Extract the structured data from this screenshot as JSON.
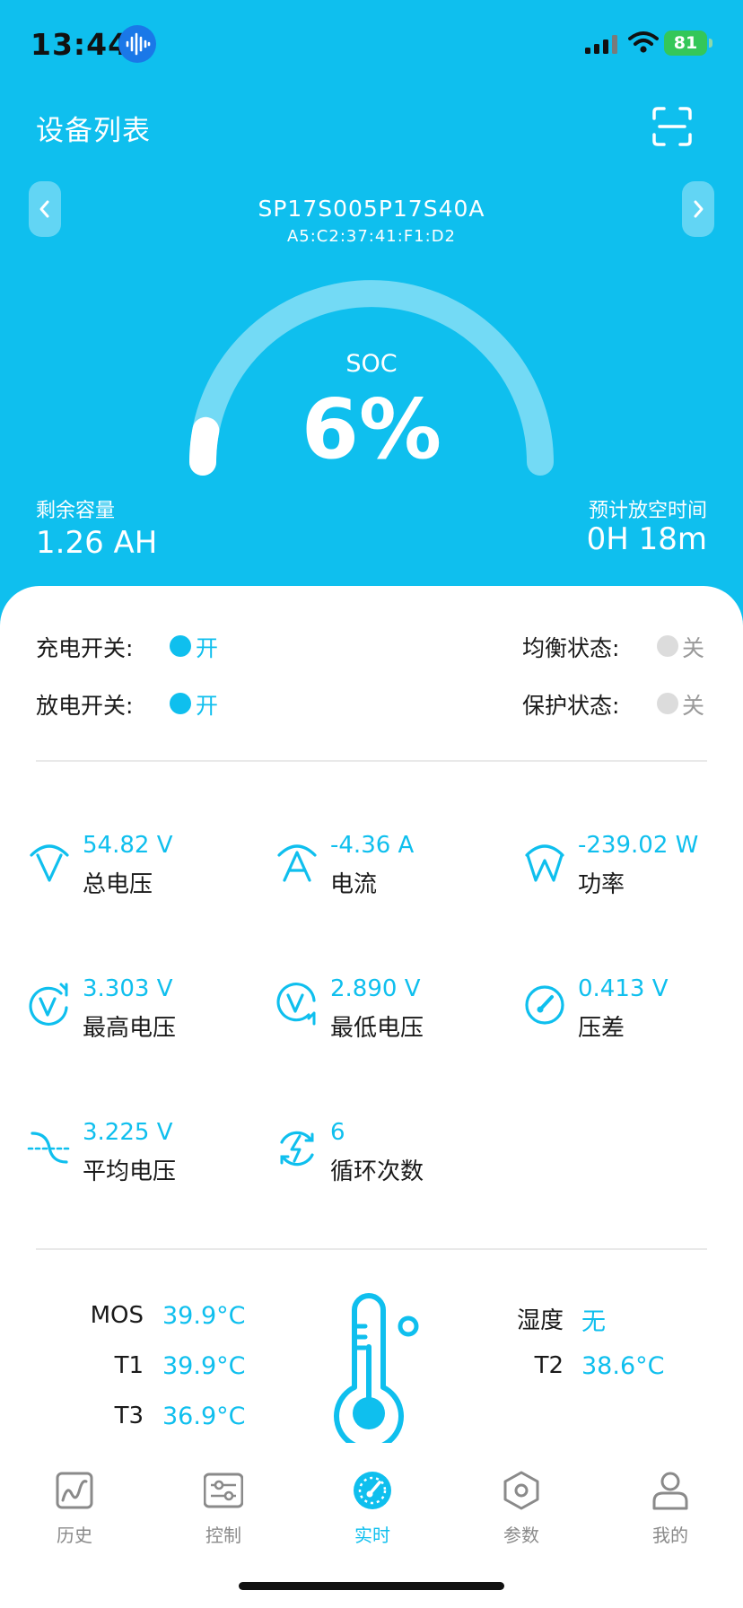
{
  "status_bar": {
    "time": "13:44",
    "battery": "81"
  },
  "header": {
    "title": "设备列表"
  },
  "device": {
    "name": "SP17S005P17S40A",
    "mac": "A5:C2:37:41:F1:D2"
  },
  "soc": {
    "label": "SOC",
    "value": "6%",
    "level": 0.06
  },
  "remaining": {
    "label": "剩余容量",
    "value": "1.26 AH"
  },
  "eta": {
    "label": "预计放空时间",
    "value": "0H 18m"
  },
  "switches": {
    "charge": {
      "label": "充电开关:",
      "state": "开"
    },
    "discharge": {
      "label": "放电开关:",
      "state": "开"
    },
    "balance": {
      "label": "均衡状态:",
      "state": "关"
    },
    "protect": {
      "label": "保护状态:",
      "state": "关"
    }
  },
  "metrics": [
    {
      "icon": "total-voltage-icon",
      "value": "54.82 V",
      "label": "总电压"
    },
    {
      "icon": "current-icon",
      "value": "-4.36 A",
      "label": "电流"
    },
    {
      "icon": "power-icon",
      "value": "-239.02 W",
      "label": "功率"
    },
    {
      "icon": "max-voltage-icon",
      "value": "3.303 V",
      "label": "最高电压"
    },
    {
      "icon": "min-voltage-icon",
      "value": "2.890 V",
      "label": "最低电压"
    },
    {
      "icon": "voltage-diff-icon",
      "value": "0.413 V",
      "label": "压差"
    },
    {
      "icon": "avg-voltage-icon",
      "value": "3.225 V",
      "label": "平均电压"
    },
    {
      "icon": "cycle-icon",
      "value": "6",
      "label": "循环次数"
    }
  ],
  "temps": {
    "mos": {
      "label": "MOS",
      "value": "39.9°C"
    },
    "t1": {
      "label": "T1",
      "value": "39.9°C"
    },
    "t3": {
      "label": "T3",
      "value": "36.9°C"
    },
    "humidity": {
      "label": "湿度",
      "value": "无"
    },
    "t2": {
      "label": "T2",
      "value": "38.6°C"
    }
  },
  "tabs": [
    {
      "label": "历史",
      "icon": "history-chart-icon",
      "active": false
    },
    {
      "label": "控制",
      "icon": "control-sliders-icon",
      "active": false
    },
    {
      "label": "实时",
      "icon": "realtime-gauge-icon",
      "active": true
    },
    {
      "label": "参数",
      "icon": "params-hex-icon",
      "active": false
    },
    {
      "label": "我的",
      "icon": "profile-icon",
      "active": false
    }
  ],
  "colors": {
    "accent": "#0fbfee",
    "text": "#1a1a1a",
    "muted": "#8a8a8a",
    "off": "#dcdcdc"
  }
}
